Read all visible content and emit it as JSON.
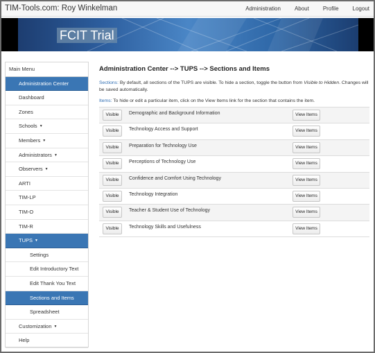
{
  "navbar": {
    "brand": "TIM-Tools.com: Roy Winkelman",
    "links": [
      "Administration",
      "About",
      "Profile",
      "Logout"
    ]
  },
  "banner": {
    "title": "FCIT Trial"
  },
  "sidebar": {
    "items": [
      {
        "label": "Main Menu",
        "type": "header"
      },
      {
        "label": "Administration Center",
        "type": "item",
        "active": true
      },
      {
        "label": "Dashboard",
        "type": "item"
      },
      {
        "label": "Zones",
        "type": "item"
      },
      {
        "label": "Schools",
        "type": "item",
        "caret": true
      },
      {
        "label": "Members",
        "type": "item",
        "caret": true
      },
      {
        "label": "Administrators",
        "type": "item",
        "caret": true
      },
      {
        "label": "Observers",
        "type": "item",
        "caret": true
      },
      {
        "label": "ARTI",
        "type": "item"
      },
      {
        "label": "TIM-LP",
        "type": "item"
      },
      {
        "label": "TIM-O",
        "type": "item"
      },
      {
        "label": "TIM-R",
        "type": "item"
      },
      {
        "label": "TUPS",
        "type": "item",
        "caret": true,
        "active": true
      },
      {
        "label": "Settings",
        "type": "sub"
      },
      {
        "label": "Edit Introductory Text",
        "type": "sub"
      },
      {
        "label": "Edit Thank You Text",
        "type": "sub"
      },
      {
        "label": "Sections and Items",
        "type": "sub",
        "active": true
      },
      {
        "label": "Spreadsheet",
        "type": "sub"
      },
      {
        "label": "Customization",
        "type": "item",
        "caret": true
      },
      {
        "label": "Help",
        "type": "item"
      }
    ]
  },
  "main": {
    "title": "Administration Center --> TUPS --> Sections and Items",
    "sections_key": "Sections:",
    "sections_text_1": " By default, all sections of the TUPS are visible. To hide a section, toggle the button from ",
    "sections_emph_1": "Visible to Hidden",
    "sections_text_2": ". Changes will be saved automatically.",
    "items_key": "Items:",
    "items_text": " To hide or edit a particular item, click on the View Items link for the section that contains the item."
  },
  "sections": {
    "visible_label": "Visible",
    "view_label": "View Items",
    "rows": [
      "Demographic and Background Information",
      "Technology Access and Support",
      "Preparation for Technology Use",
      "Perceptions of Technology Use",
      "Confidence and Comfort Using Technology",
      "Technology Integration",
      "Teacher & Student Use of Technology",
      "Technology Skills and Usefulness"
    ]
  },
  "colors": {
    "accent": "#3a76b4",
    "link": "#2e6db2"
  }
}
